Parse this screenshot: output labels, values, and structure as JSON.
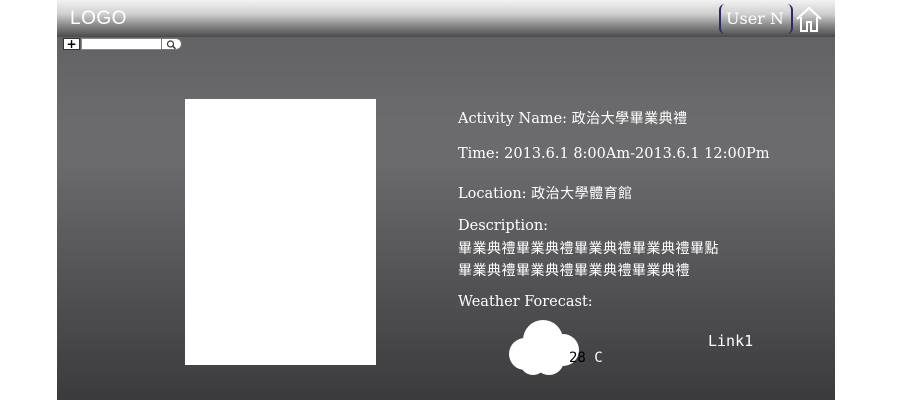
{
  "header": {
    "logo_text": "LOGO",
    "user_name": "User N",
    "home_icon": "home-icon"
  },
  "search": {
    "add_label": "+",
    "placeholder": "",
    "value": "",
    "icon": "search-icon"
  },
  "event": {
    "activity_label": "Activity Name: ",
    "activity_value": "政治大學畢業典禮",
    "time_label": "Time: ",
    "time_value": "2013.6.1 8:00Am-2013.6.1 12:00Pm",
    "location_label": "Location: ",
    "location_value": "政治大學體育館",
    "description_label": "Description:",
    "description_lines": [
      "畢業典禮畢業典禮畢業典禮畢業典禮畢點",
      "畢業典禮畢業典禮畢業典禮畢業典禮"
    ],
    "weather_label": "Weather Forecast:",
    "weather_icon": "cloud-icon",
    "temperature_value": "28",
    "temperature_unit": " C",
    "link_label": "Link1"
  },
  "colors": {
    "background_top": "#5f5f61",
    "background_bottom": "#3b3b3d",
    "text": "#ffffff",
    "user_border": "#2a2a6a"
  }
}
